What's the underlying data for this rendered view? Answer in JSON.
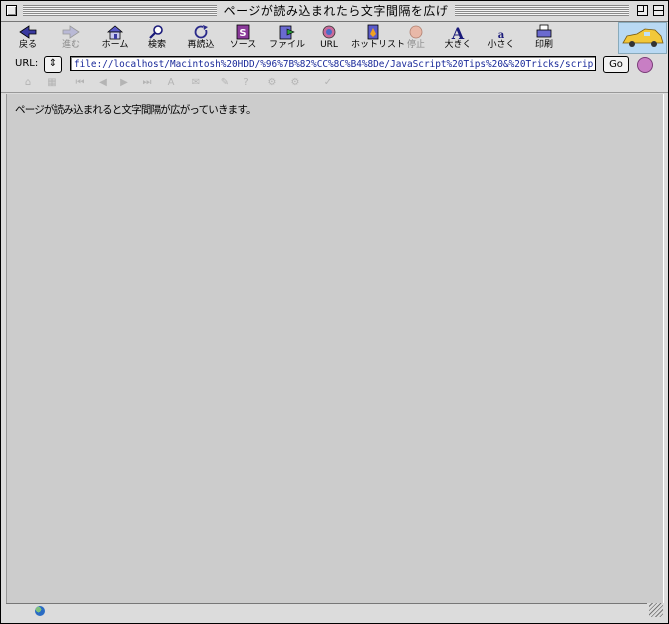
{
  "window": {
    "title": "ページが読み込まれたら文字間隔を広げる"
  },
  "toolbar": {
    "buttons": [
      {
        "label": "戻る",
        "icon": "back-arrow-icon",
        "enabled": true
      },
      {
        "label": "進む",
        "icon": "forward-arrow-icon",
        "enabled": false
      },
      {
        "label": "ホーム",
        "icon": "home-icon",
        "enabled": true
      },
      {
        "label": "検索",
        "icon": "search-icon",
        "enabled": true
      },
      {
        "label": "再読込",
        "icon": "reload-icon",
        "enabled": true
      },
      {
        "label": "ソース",
        "icon": "source-icon",
        "enabled": true
      },
      {
        "label": "ファイル",
        "icon": "file-icon",
        "enabled": true
      },
      {
        "label": "URL",
        "icon": "url-icon",
        "enabled": true
      },
      {
        "label": "ホットリスト",
        "icon": "hotlist-icon",
        "enabled": true
      },
      {
        "label": "停止",
        "icon": "stop-icon",
        "enabled": false
      },
      {
        "label": "大きく",
        "icon": "larger-text-icon",
        "enabled": true
      },
      {
        "label": "小さく",
        "icon": "smaller-text-icon",
        "enabled": true
      },
      {
        "label": "印刷",
        "icon": "print-icon",
        "enabled": true
      }
    ]
  },
  "urlbar": {
    "label": "URL:",
    "popup_symbol": "⇕",
    "value": "file://localhost/Macintosh%20HDD/%96%7B%82%CC%8C%B4%8De/JavaScript%20Tips%20&%20Tricks/scrip",
    "go_label": "Go"
  },
  "content": {
    "text": "ページが読み込まれると文字間隔が広がっていきます。"
  },
  "colors": {
    "accent": "#1a2a9a",
    "content_bg": "#cccccc",
    "chrome_bg": "#dcdcdc"
  }
}
